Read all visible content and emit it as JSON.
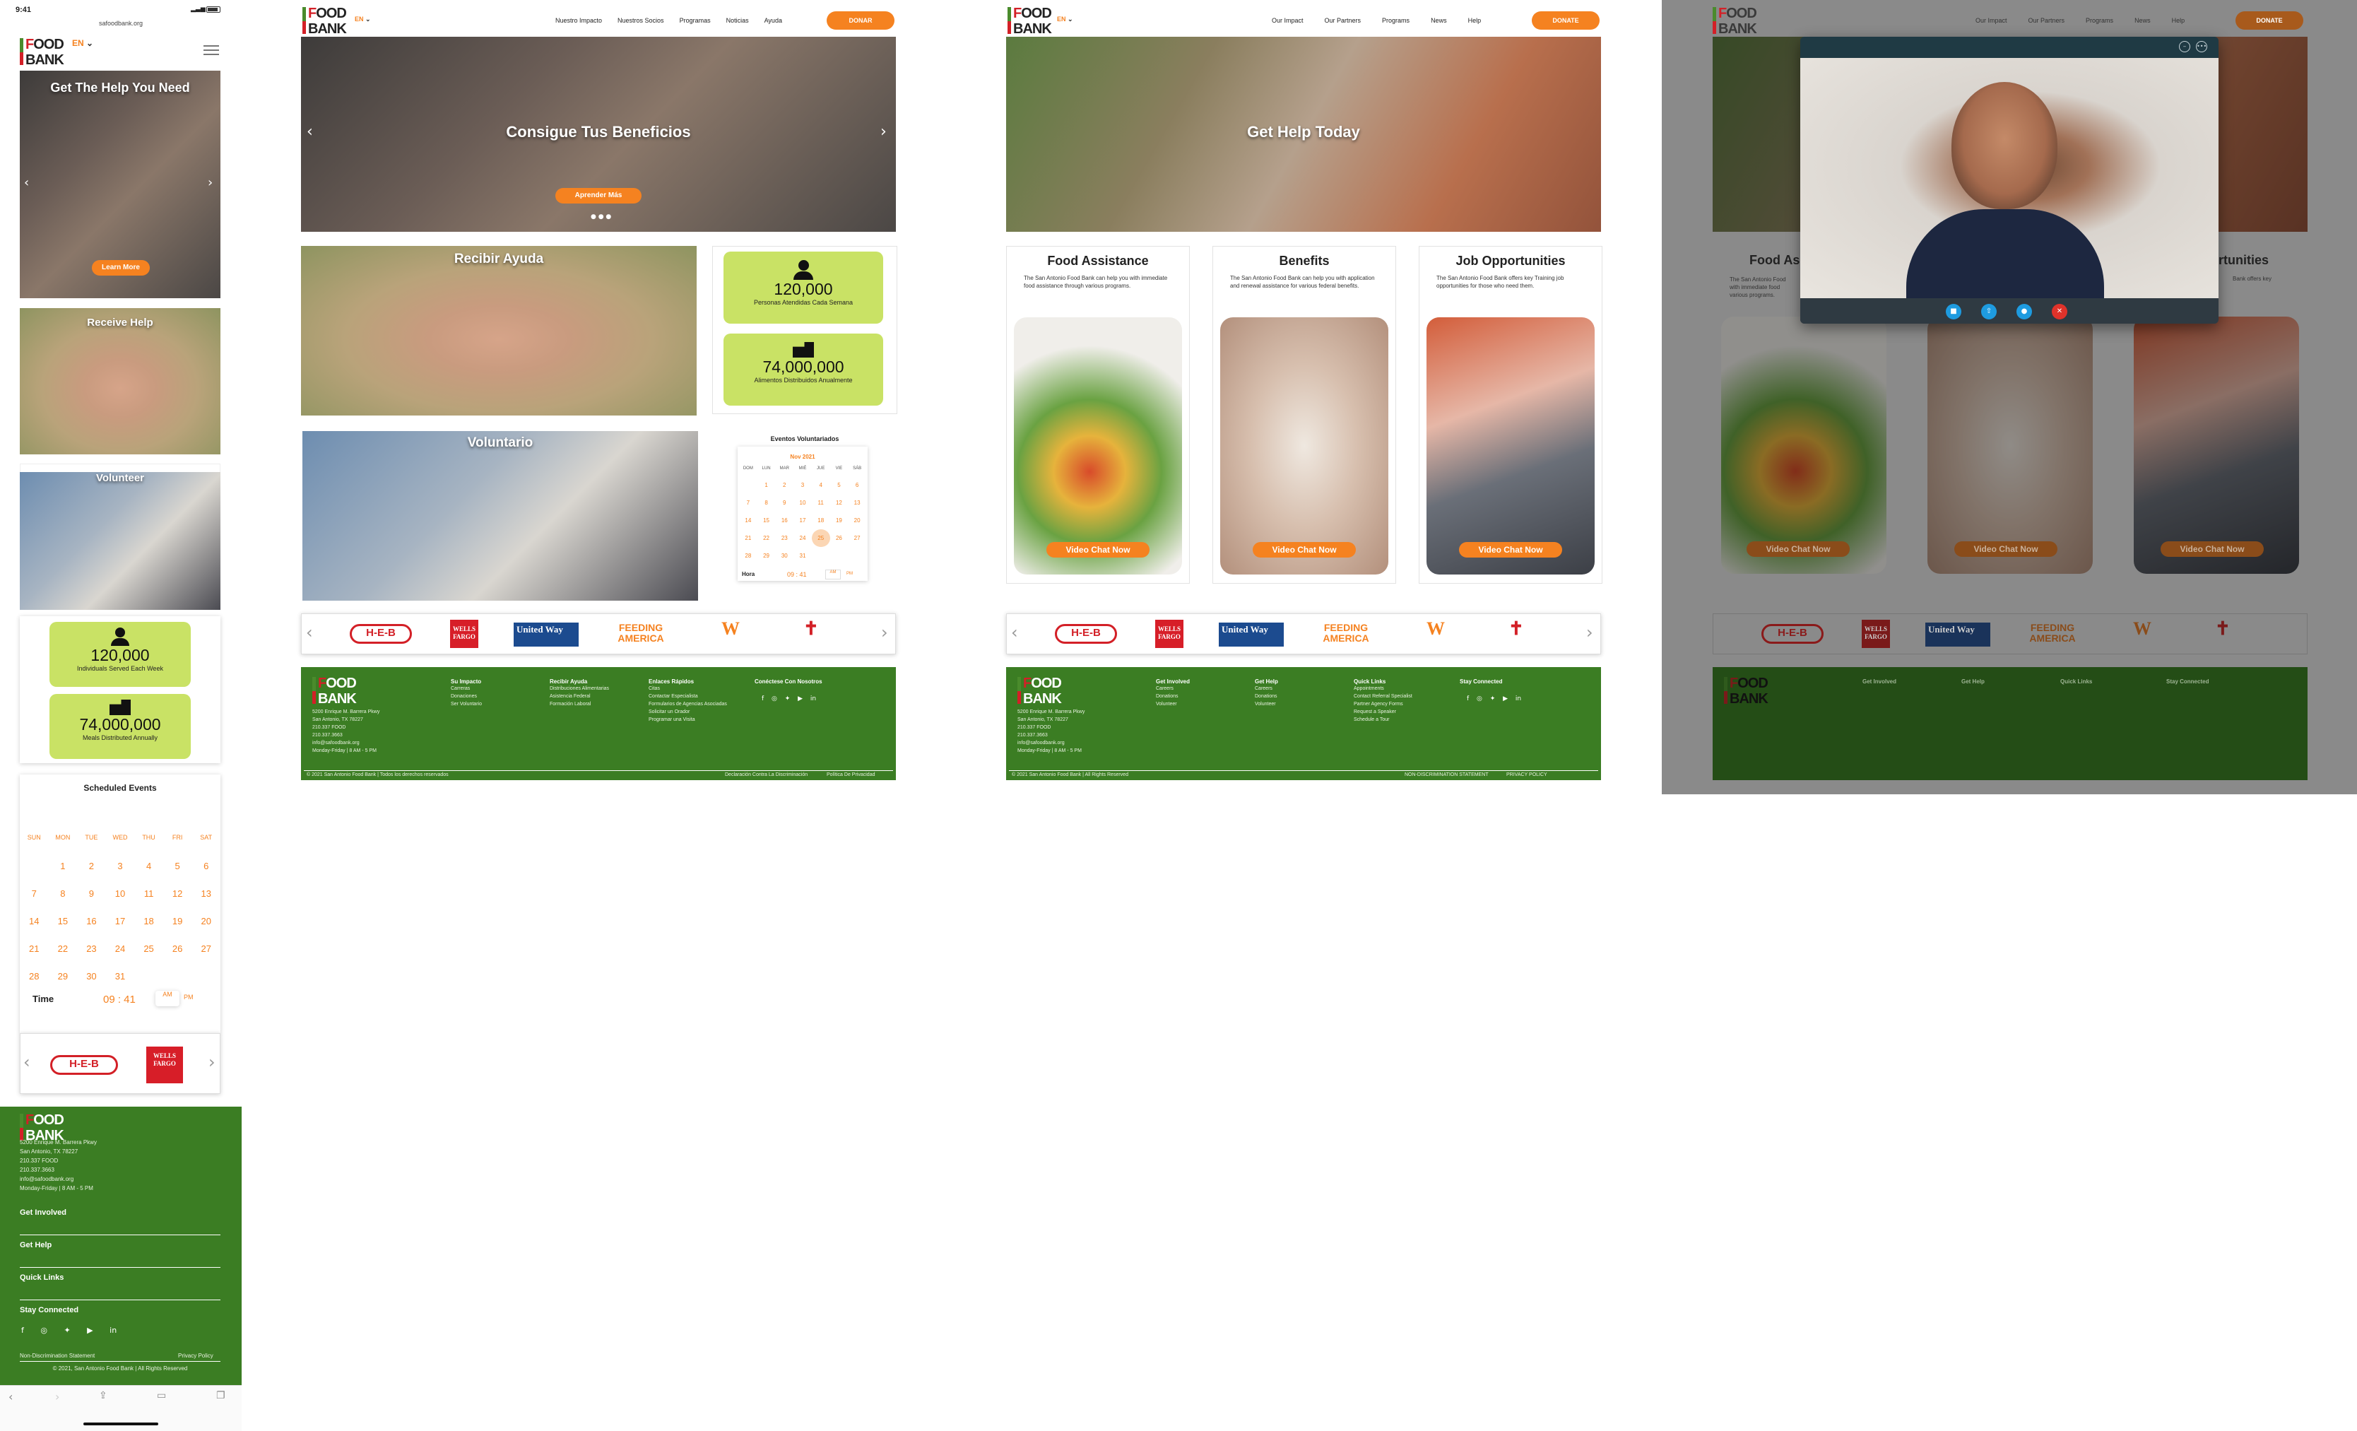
{
  "colors": {
    "green": "#3b7d23",
    "orange": "#f58220",
    "lime": "#c9e265",
    "red": "#d32027"
  },
  "mobile": {
    "status_time": "9:41",
    "url": "safoodbank.org",
    "lang": "EN",
    "hero_title": "Get The Help You Need",
    "hero_cta": "Learn More",
    "receive_help": "Receive Help",
    "volunteer": "Volunteer",
    "stat1_value": "120,000",
    "stat1_caption": "Individuals Served Each Week",
    "stat2_value": "74,000,000",
    "stat2_caption": "Meals Distributed Annually",
    "events_title": "Scheduled Events",
    "weekdays": [
      "SUN",
      "MON",
      "TUE",
      "WED",
      "THU",
      "FRI",
      "SAT"
    ],
    "days": [
      "",
      "1",
      "2",
      "3",
      "4",
      "5",
      "6",
      "7",
      "8",
      "9",
      "10",
      "11",
      "12",
      "13",
      "14",
      "15",
      "16",
      "17",
      "18",
      "19",
      "20",
      "21",
      "22",
      "23",
      "24",
      "25",
      "26",
      "27",
      "28",
      "29",
      "30",
      "31",
      "",
      "",
      ""
    ],
    "time_label": "Time",
    "time_value": "09 : 41",
    "am": "AM",
    "pm": "PM",
    "footer_address": [
      "5200 Enrique M. Barrera Pkwy",
      "San Antonio, TX 78227",
      "210.337 FOOD",
      "210.337.3663",
      "info@safoodbank.org",
      "Monday-Friday | 8 AM - 5 PM"
    ],
    "footer_sections": [
      "Get Involved",
      "Get Help",
      "Quick Links",
      "Stay Connected"
    ],
    "non_discrimination": "Non-Discrimination Statement",
    "privacy": "Privacy Policy",
    "copyright": "© 2021, San Antonio Food Bank | All Rights Reserved"
  },
  "spanish": {
    "lang": "EN",
    "nav": [
      "Nuestro Impacto",
      "Nuestros Socios",
      "Programas",
      "Noticias",
      "Ayuda"
    ],
    "donate": "DONAR",
    "hero_title": "Consigue Tus Beneficios",
    "hero_cta": "Aprender Más",
    "receive_help": "Recibir Ayuda",
    "volunteer": "Voluntario",
    "stat1_value": "120,000",
    "stat1_caption": "Personas Atendidas Cada Semana",
    "stat2_value": "74,000,000",
    "stat2_caption": "Alimentos Distribuidos Anualmente",
    "events_title": "Eventos Voluntariados",
    "month": "Nov 2021",
    "weekdays": [
      "DOM",
      "LUN",
      "MAR",
      "MIÉ",
      "JUE",
      "VIE",
      "SÁB"
    ],
    "days": [
      "",
      "1",
      "2",
      "3",
      "4",
      "5",
      "6",
      "7",
      "8",
      "9",
      "10",
      "11",
      "12",
      "13",
      "14",
      "15",
      "16",
      "17",
      "18",
      "19",
      "20",
      "21",
      "22",
      "23",
      "24",
      "25",
      "26",
      "27",
      "28",
      "29",
      "30",
      "31",
      "",
      "",
      ""
    ],
    "time_label": "Hora",
    "time_value": "09 : 41",
    "am": "AM",
    "pm": "PM",
    "footer_address": [
      "5200 Enrique M. Barrera Pkwy",
      "San Antonio, TX 78227",
      "210.337 FOOD",
      "210.337.3663",
      "info@safoodbank.org",
      "Monday-Friday | 8 AM - 5 PM"
    ],
    "footer_cols": [
      {
        "title": "Su Impacto",
        "items": [
          "Carreras",
          "Donaciones",
          "Ser Voluntario"
        ]
      },
      {
        "title": "Recibir Ayuda",
        "items": [
          "Distribuciones Alimentarias",
          "Asistencia Federal",
          "Formación Laboral"
        ]
      },
      {
        "title": "Enlaces Rápidos",
        "items": [
          "Citas",
          "Contactar Especialista",
          "Formularios de Agencias Asociadas",
          "Solicitar un Orador",
          "Programar una Visita"
        ]
      },
      {
        "title": "Conéctese Con Nosotros",
        "items": []
      }
    ],
    "copyright": "© 2021 San Antonio Food Bank | Todos los derechos reservados",
    "non_discrimination": "Declaración Contra La Discriminación",
    "privacy": "Política De Privacidad"
  },
  "english": {
    "lang": "EN",
    "nav": [
      "Our Impact",
      "Our Partners",
      "Programs",
      "News",
      "Help"
    ],
    "donate": "DONATE",
    "hero_title": "Get Help Today",
    "cards": [
      {
        "title": "Food Assistance",
        "text": "The San Antonio Food Bank can help you with immediate food assistance through various programs.",
        "cta": "Video Chat Now"
      },
      {
        "title": "Benefits",
        "text": "The San Antonio Food Bank can help you with application and renewal assistance for various federal benefits.",
        "cta": "Video Chat Now"
      },
      {
        "title": "Job Opportunities",
        "text": "The San Antonio Food Bank offers key Training job opportunities for those who need them.",
        "cta": "Video Chat Now"
      }
    ],
    "footer_address": [
      "5200 Enrique M. Barrera Pkwy",
      "San Antonio, TX 78227",
      "210.337 FOOD",
      "210.337.3663",
      "info@safoodbank.org",
      "Monday-Friday | 8 AM - 5 PM"
    ],
    "footer_cols": [
      {
        "title": "Get Involved",
        "items": [
          "Careers",
          "Donations",
          "Volunteer"
        ]
      },
      {
        "title": "Get Help",
        "items": [
          "Careers",
          "Donations",
          "Volunteer"
        ]
      },
      {
        "title": "Quick Links",
        "items": [
          "Appointments",
          "Contact Referral Specialist",
          "Partner Agency Forms",
          "Request a Speaker",
          "Schedule a Tour"
        ]
      },
      {
        "title": "Stay Connected",
        "items": []
      }
    ],
    "copyright": "© 2021 San Antonio Food Bank | All Rights Reserved",
    "non_discrimination": "NON-DISCRIMINATION STATEMENT",
    "privacy": "PRIVACY POLICY"
  },
  "video": {
    "cards_visible": [
      "Food As",
      "rtunities"
    ],
    "card_text_left": [
      "The San Antonio Food",
      "with immediate food",
      "various programs."
    ],
    "card_text_right": "Bank offers key"
  },
  "sponsors": [
    "H-E-B",
    "WELLS FARGO",
    "United Way",
    "FEEDING AMERICA",
    "W",
    "✝"
  ]
}
